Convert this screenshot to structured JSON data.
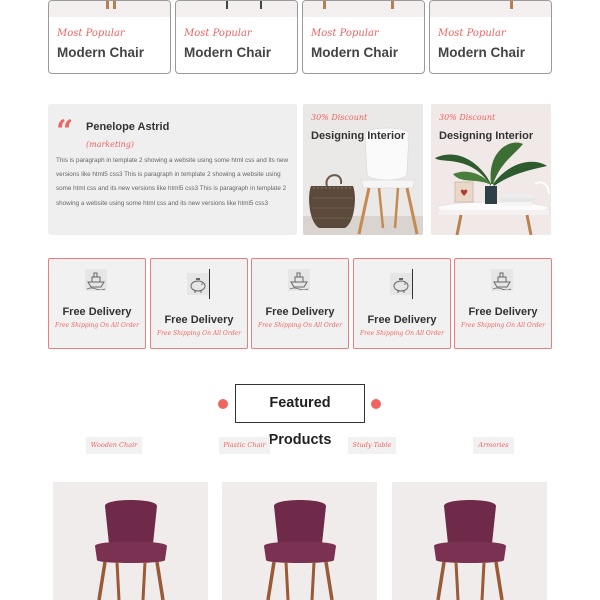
{
  "top_products": [
    {
      "tag": "Most Popular",
      "title": "Modern Chair"
    },
    {
      "tag": "Most Popular",
      "title": "Modern Chair"
    },
    {
      "tag": "Most Popular",
      "title": "Modern Chair"
    },
    {
      "tag": "Most Popular",
      "title": "Modern Chair"
    }
  ],
  "testimonial": {
    "name": "Penelope Astrid",
    "role": "(marketing)",
    "text": "This is paragraph in template 2 showing a website using some html css and its new versions like html5 css3 This is paragraph in template 2 showing a website using some html css and its new versions like html5 css3 This is paragraph in template 2 showing a website using some html css and its new versions like html5 css3"
  },
  "discount_cards": [
    {
      "tag": "30% Discount",
      "title": "Designing Interior"
    },
    {
      "tag": "30% Discount",
      "title": "Designing Interior"
    }
  ],
  "delivery": [
    {
      "title": "Free Delivery",
      "subtitle": "Free Shipping On All Order",
      "icon": "ship-icon"
    },
    {
      "title": "Free Delivery",
      "subtitle": "Free Shipping On All Order",
      "icon": "piggy-bank-icon"
    },
    {
      "title": "Free Delivery",
      "subtitle": "Free Shipping On All Order",
      "icon": "ship-icon"
    },
    {
      "title": "Free Delivery",
      "subtitle": "Free Shipping On All Order",
      "icon": "piggy-bank-icon"
    },
    {
      "title": "Free Delivery",
      "subtitle": "Free Shipping On All Order",
      "icon": "ship-icon"
    }
  ],
  "featured": {
    "title": "Featured Products",
    "categories": [
      "Wooden Chair",
      "Plastic Chair",
      "Study Table",
      "Armories"
    ]
  },
  "colors": {
    "accent": "#ef6461",
    "card_bg": "#efefef",
    "chair_seat": "#6e2a48",
    "wood": "#9a5a35"
  }
}
